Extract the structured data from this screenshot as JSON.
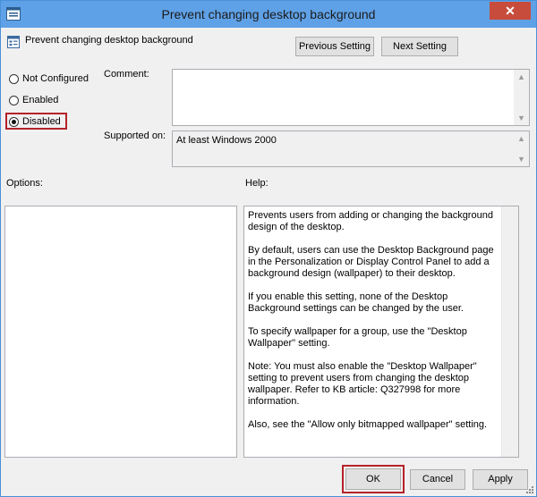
{
  "window": {
    "title": "Prevent changing desktop background",
    "close_glyph": "✕"
  },
  "header": {
    "label": "Prevent changing desktop background"
  },
  "nav": {
    "previous": "Previous Setting",
    "next": "Next Setting"
  },
  "state": {
    "options": [
      {
        "label": "Not Configured",
        "selected": false
      },
      {
        "label": "Enabled",
        "selected": false
      },
      {
        "label": "Disabled",
        "selected": true
      }
    ]
  },
  "comment": {
    "label": "Comment:",
    "value": ""
  },
  "supported": {
    "label": "Supported on:",
    "value": "At least Windows 2000"
  },
  "options_label": "Options:",
  "help_label": "Help:",
  "help": {
    "paragraphs": [
      "Prevents users from adding or changing the background design of the desktop.",
      "By default, users can use the Desktop Background page in the Personalization or Display Control Panel to add a background design (wallpaper) to their desktop.",
      "If you enable this setting, none of the Desktop Background settings can be changed by the user.",
      "To specify wallpaper for a group, use the \"Desktop Wallpaper\" setting.",
      "Note: You must also enable the \"Desktop Wallpaper\" setting to prevent users from changing the desktop wallpaper. Refer to KB article: Q327998 for more information.",
      "Also, see the \"Allow only bitmapped wallpaper\" setting."
    ]
  },
  "footer": {
    "ok": "OK",
    "cancel": "Cancel",
    "apply": "Apply"
  },
  "icons": {
    "scroll_up": "▲",
    "scroll_down": "▼"
  },
  "colors": {
    "titlebar": "#5fa1e6",
    "close": "#c74c3c",
    "highlight": "#b52229"
  }
}
